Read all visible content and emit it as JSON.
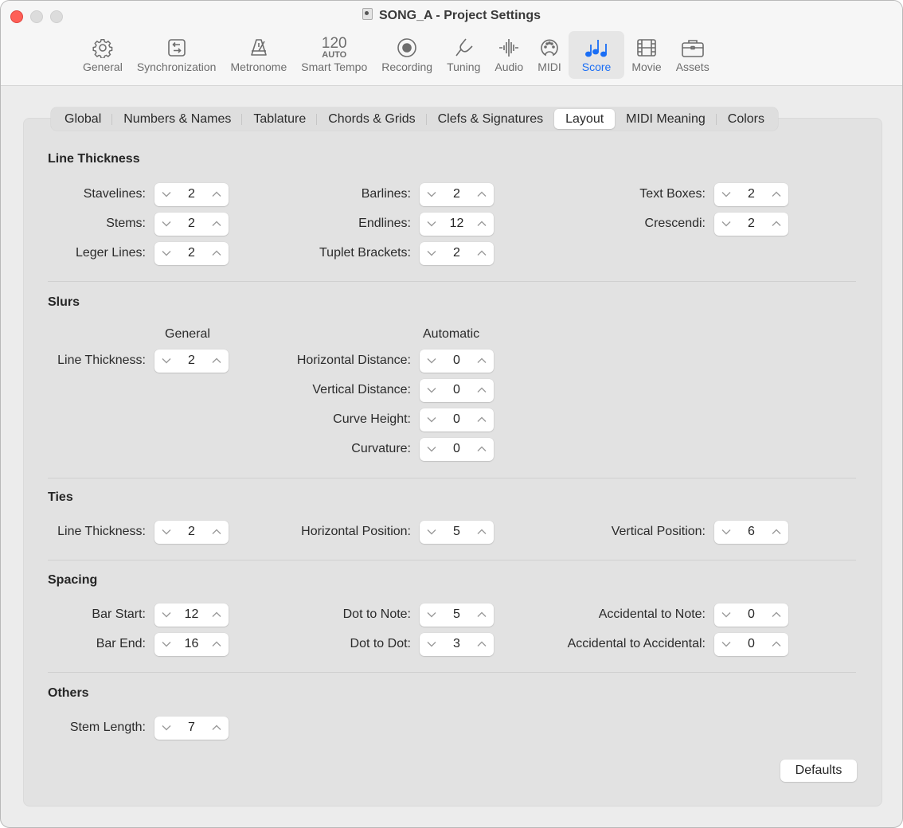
{
  "window": {
    "title": "SONG_A - Project Settings"
  },
  "toolbar": {
    "items": [
      {
        "label": "General",
        "icon": "gear-icon"
      },
      {
        "label": "Synchronization",
        "icon": "sync-arrows-icon"
      },
      {
        "label": "Metronome",
        "icon": "metronome-icon"
      },
      {
        "label": "Smart Tempo",
        "icon": "tempo-readout",
        "tempo_value": "120",
        "tempo_mode": "AUTO"
      },
      {
        "label": "Recording",
        "icon": "record-icon"
      },
      {
        "label": "Tuning",
        "icon": "tuning-fork-icon"
      },
      {
        "label": "Audio",
        "icon": "waveform-icon"
      },
      {
        "label": "MIDI",
        "icon": "midi-port-icon"
      },
      {
        "label": "Score",
        "icon": "music-notes-icon",
        "active": true
      },
      {
        "label": "Movie",
        "icon": "film-icon"
      },
      {
        "label": "Assets",
        "icon": "briefcase-icon"
      }
    ],
    "accent_color": "#1a6ef5"
  },
  "tabs": [
    {
      "label": "Global"
    },
    {
      "label": "Numbers & Names"
    },
    {
      "label": "Tablature"
    },
    {
      "label": "Chords & Grids"
    },
    {
      "label": "Clefs & Signatures"
    },
    {
      "label": "Layout",
      "active": true
    },
    {
      "label": "MIDI Meaning"
    },
    {
      "label": "Colors"
    }
  ],
  "sections": {
    "line_thickness": {
      "title": "Line Thickness",
      "fields": {
        "stavelines": {
          "label": "Stavelines:",
          "value": "2"
        },
        "stems": {
          "label": "Stems:",
          "value": "2"
        },
        "leger_lines": {
          "label": "Leger Lines:",
          "value": "2"
        },
        "barlines": {
          "label": "Barlines:",
          "value": "2"
        },
        "endlines": {
          "label": "Endlines:",
          "value": "12"
        },
        "tuplet_brackets": {
          "label": "Tuplet Brackets:",
          "value": "2"
        },
        "text_boxes": {
          "label": "Text Boxes:",
          "value": "2"
        },
        "crescendi": {
          "label": "Crescendi:",
          "value": "2"
        }
      }
    },
    "slurs": {
      "title": "Slurs",
      "general_header": "General",
      "automatic_header": "Automatic",
      "fields": {
        "line_thickness": {
          "label": "Line Thickness:",
          "value": "2"
        },
        "horizontal_distance": {
          "label": "Horizontal Distance:",
          "value": "0"
        },
        "vertical_distance": {
          "label": "Vertical Distance:",
          "value": "0"
        },
        "curve_height": {
          "label": "Curve Height:",
          "value": "0"
        },
        "curvature": {
          "label": "Curvature:",
          "value": "0"
        }
      }
    },
    "ties": {
      "title": "Ties",
      "fields": {
        "line_thickness": {
          "label": "Line Thickness:",
          "value": "2"
        },
        "horizontal_position": {
          "label": "Horizontal Position:",
          "value": "5"
        },
        "vertical_position": {
          "label": "Vertical Position:",
          "value": "6"
        }
      }
    },
    "spacing": {
      "title": "Spacing",
      "fields": {
        "bar_start": {
          "label": "Bar Start:",
          "value": "12"
        },
        "bar_end": {
          "label": "Bar End:",
          "value": "16"
        },
        "dot_to_note": {
          "label": "Dot to Note:",
          "value": "5"
        },
        "dot_to_dot": {
          "label": "Dot to Dot:",
          "value": "3"
        },
        "accidental_to_note": {
          "label": "Accidental to Note:",
          "value": "0"
        },
        "accidental_to_accidental": {
          "label": "Accidental to Accidental:",
          "value": "0"
        }
      }
    },
    "others": {
      "title": "Others",
      "fields": {
        "stem_length": {
          "label": "Stem Length:",
          "value": "7"
        }
      }
    }
  },
  "buttons": {
    "defaults_label": "Defaults"
  }
}
